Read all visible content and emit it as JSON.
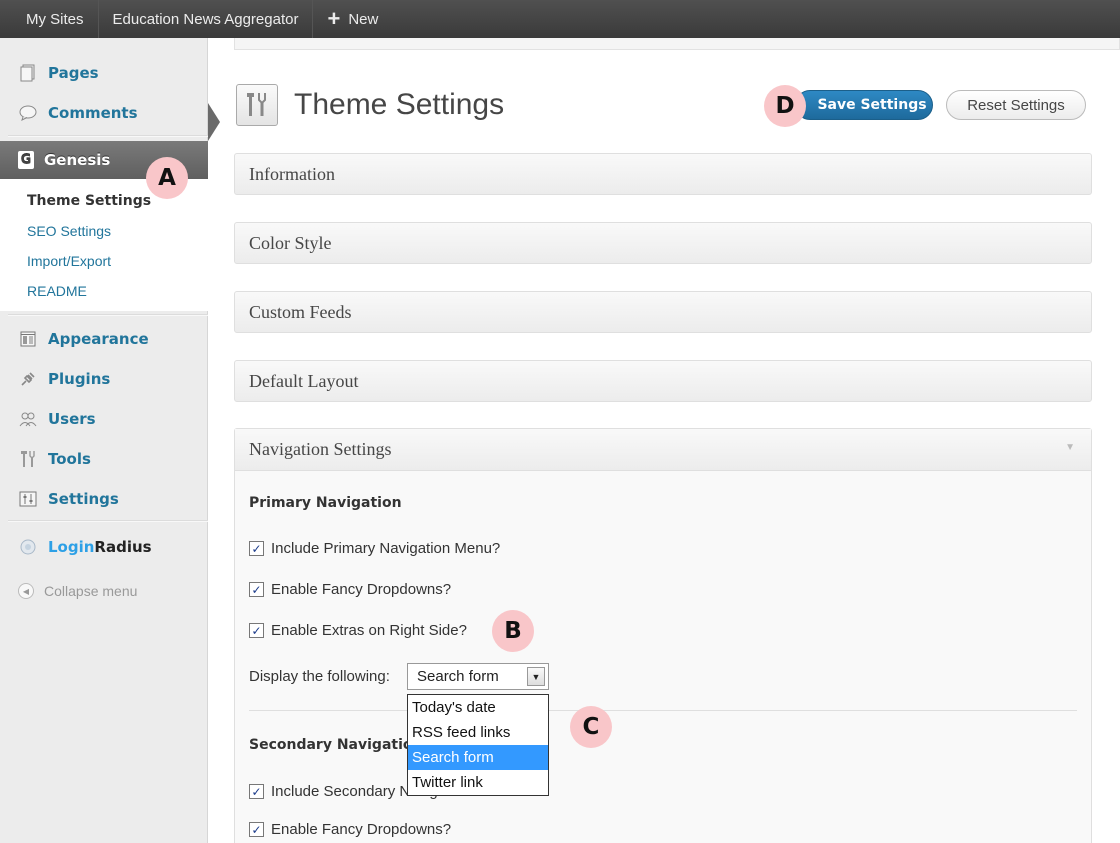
{
  "admin_bar": {
    "my_sites": "My Sites",
    "site_name": "Education News Aggregator",
    "new_plus": "+",
    "new_label": "New"
  },
  "sidebar": {
    "pages": "Pages",
    "comments": "Comments",
    "genesis": "Genesis",
    "genesis_icon": "G",
    "submenu": [
      "Theme Settings",
      "SEO Settings",
      "Import/Export",
      "README"
    ],
    "appearance": "Appearance",
    "plugins": "Plugins",
    "users": "Users",
    "tools": "Tools",
    "settings": "Settings",
    "login_radius": {
      "part1": "Login",
      "part2": "Radius"
    },
    "collapse": "Collapse menu"
  },
  "header": {
    "title": "Theme Settings",
    "save_button": "Save Settings",
    "reset_button": "Reset Settings"
  },
  "metaboxes": [
    "Information",
    "Color Style",
    "Custom Feeds",
    "Default Layout"
  ],
  "navigation": {
    "title": "Navigation Settings",
    "primary_title": "Primary Navigation",
    "primary_options": [
      {
        "label": "Include Primary Navigation Menu?",
        "checked": true
      },
      {
        "label": "Enable Fancy Dropdowns?",
        "checked": true
      },
      {
        "label": "Enable Extras on Right Side?",
        "checked": true
      }
    ],
    "display_label": "Display the following:",
    "select_value": "Search form",
    "select_options": [
      "Today's date",
      "RSS feed links",
      "Search form",
      "Twitter link"
    ],
    "secondary_title": "Secondary Navigation",
    "secondary_options": [
      {
        "label": "Include Secondary Navigation Menu?",
        "checked": true
      },
      {
        "label": "Enable Fancy Dropdowns?",
        "checked": true
      }
    ]
  },
  "markers": {
    "a": "A",
    "b": "B",
    "c": "C",
    "d": "D"
  },
  "colors": {
    "admin_bar": "#464646",
    "link": "#21759b",
    "primary_button": "#21759b",
    "marker": "#f9c6c9",
    "selected_option": "#3399ff"
  },
  "icons": [
    "pages-icon",
    "comments-icon",
    "genesis-icon",
    "appearance-icon",
    "plugins-icon",
    "users-icon",
    "tools-icon",
    "settings-icon",
    "loginradius-icon",
    "collapse-icon",
    "theme-settings-icon",
    "dropdown-arrow-icon",
    "toggle-arrow-icon"
  ]
}
